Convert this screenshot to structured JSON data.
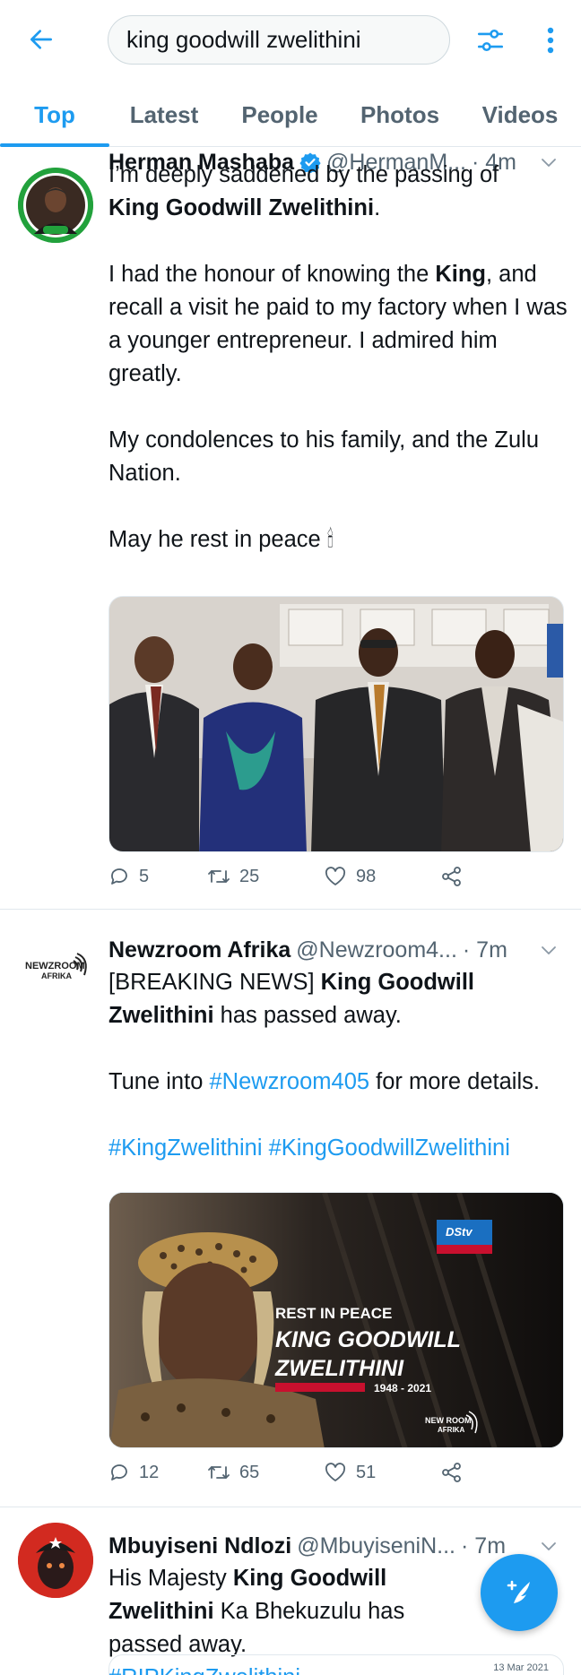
{
  "search": {
    "query": "king goodwill zwelithini"
  },
  "tabs": [
    {
      "label": "Top",
      "active": true
    },
    {
      "label": "Latest"
    },
    {
      "label": "People"
    },
    {
      "label": "Photos"
    },
    {
      "label": "Videos"
    }
  ],
  "tweets": [
    {
      "name": "Herman Mashaba",
      "handle": "@HermanM...",
      "time": "· 4m",
      "verified": true,
      "lines": {
        "p1a": "I’m deeply saddened by the passing of",
        "p1b": "King Goodwill Zwelithini",
        "p1c": ".",
        "p2a": "I had the honour of knowing the ",
        "p2b": "King",
        "p2c": ", and recall a visit he paid to my factory when I was a younger entrepreneur. I admired him greatly.",
        "p3": "My condolences to his family, and the Zulu Nation.",
        "p4": "May he rest in peace 🕯"
      },
      "replies": "5",
      "retweets": "25",
      "likes": "98"
    },
    {
      "name": "Newzroom Afrika",
      "handle": "@Newzroom4...",
      "time": "· 7m",
      "lines": {
        "p1a": "[BREAKING NEWS] ",
        "p1b": "King Goodwill Zwelithini",
        "p1c": " has passed away.",
        "p2a": "Tune into ",
        "p2b": "#Newzroom405",
        "p2c": " for more details.",
        "p3": "#KingZwelithini #KingGoodwillZwelithini"
      },
      "media": {
        "line1": "REST IN PEACE",
        "line2": "KING GOODWILL",
        "line3": "ZWELITHINI",
        "years": "1948 - 2021",
        "badge": "DStv"
      },
      "replies": "12",
      "retweets": "65",
      "likes": "51"
    },
    {
      "name": "Mbuyiseni Ndlozi",
      "handle": "@MbuyiseniN...",
      "time": "· 7m",
      "lines": {
        "p1a": "His Majesty ",
        "p1b": "King Goodwill Zwelithini",
        "p1c": " Ka Bhekuzulu has passed away.",
        "p2": "#RIPKingZwelithini"
      },
      "peek_date": "13 Mar 2021"
    }
  ],
  "colors": {
    "accent": "#1d9bf0",
    "text": "#0f1419",
    "muted": "#536471",
    "border": "#e1e8ed"
  },
  "icons": [
    "back-arrow-icon",
    "filter-icon",
    "more-vertical-icon",
    "verified-icon",
    "chevron-down-icon",
    "reply-icon",
    "retweet-icon",
    "like-icon",
    "share-icon",
    "compose-icon"
  ]
}
